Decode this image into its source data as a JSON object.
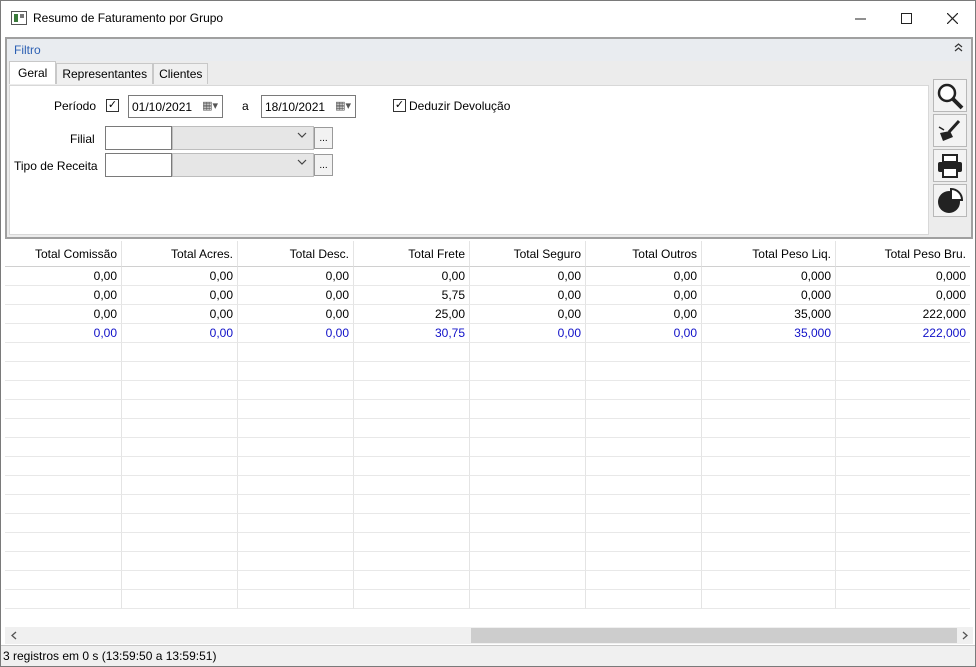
{
  "window": {
    "title": "Resumo de Faturamento por Grupo"
  },
  "filter": {
    "title": "Filtro",
    "tabs": [
      "Geral",
      "Representantes",
      "Clientes"
    ],
    "periodo_label": "Período",
    "periodo_checked": true,
    "date_from": "01/10/2021",
    "date_sep": "a",
    "date_to": "18/10/2021",
    "deduzir_label": "Deduzir Devolução",
    "deduzir_checked": true,
    "filial_label": "Filial",
    "tipo_receita_label": "Tipo de Receita",
    "ellipsis": "..."
  },
  "tools": [
    "search-icon",
    "clear-filter-icon",
    "print-icon",
    "pie-chart-icon"
  ],
  "grid": {
    "columns": [
      "Total Comissão",
      "Total Acres.",
      "Total Desc.",
      "Total Frete",
      "Total Seguro",
      "Total Outros",
      "Total Peso Liq.",
      "Total Peso Bru."
    ],
    "rows": [
      [
        "0,00",
        "0,00",
        "0,00",
        "0,00",
        "0,00",
        "0,00",
        "0,000",
        "0,000"
      ],
      [
        "0,00",
        "0,00",
        "0,00",
        "5,75",
        "0,00",
        "0,00",
        "0,000",
        "0,000"
      ],
      [
        "0,00",
        "0,00",
        "0,00",
        "25,00",
        "0,00",
        "0,00",
        "35,000",
        "222,000"
      ]
    ],
    "totals": [
      "0,00",
      "0,00",
      "0,00",
      "30,75",
      "0,00",
      "0,00",
      "35,000",
      "222,000"
    ],
    "total_color": "#1010c8"
  },
  "status": {
    "text": "3 registros em 0 s (13:59:50 a 13:59:51)"
  }
}
